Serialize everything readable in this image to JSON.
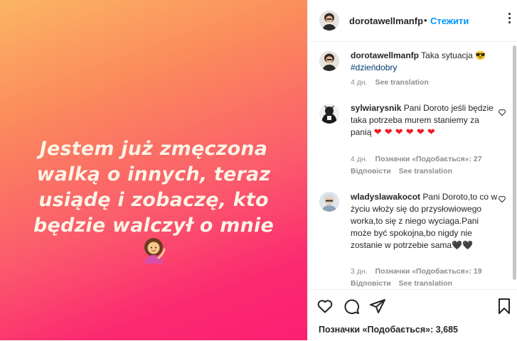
{
  "post": {
    "quote_lines": [
      "Jestem już zmęczona",
      "walką o innych, teraz",
      "usiądę i zobaczę, kto",
      "będzie walczył o mnie"
    ]
  },
  "header": {
    "username": "dorotawellmanfp",
    "dot": "•",
    "follow_label": "Стежити"
  },
  "caption": {
    "username": "dorotawellmanfp",
    "text": "Taka sytuacja 😎",
    "hashtag": "#dzieńdobry",
    "time": "4 дн.",
    "translate": "See translation"
  },
  "comments": [
    {
      "username": "sylwiarysnik",
      "text": "Pani Doroto jeśli będzie taka potrzeba murem staniemy za panią",
      "time": "4 дн.",
      "likes": "Позначки «Подобається»: 27",
      "reply": "Відповісти",
      "translate": "See translation"
    },
    {
      "username": "wladyslawakocot",
      "text": "Pani Doroto,to co w życiu włoży się do przysłowiowego worka,to się z niego wyciaga.Pani może być spokojna,bo nigdy nie zostanie w potrzebie sama🖤🖤",
      "time": "3 дн.",
      "likes": "Позначки «Подобається»: 19",
      "reply": "Відповісти",
      "translate": "See translation"
    }
  ],
  "likes_summary": "Позначки «Подобається»: 3,685",
  "colors": {
    "accent": "#0095f6",
    "heart": "#ed1c24",
    "muted": "#8e8e8e"
  }
}
